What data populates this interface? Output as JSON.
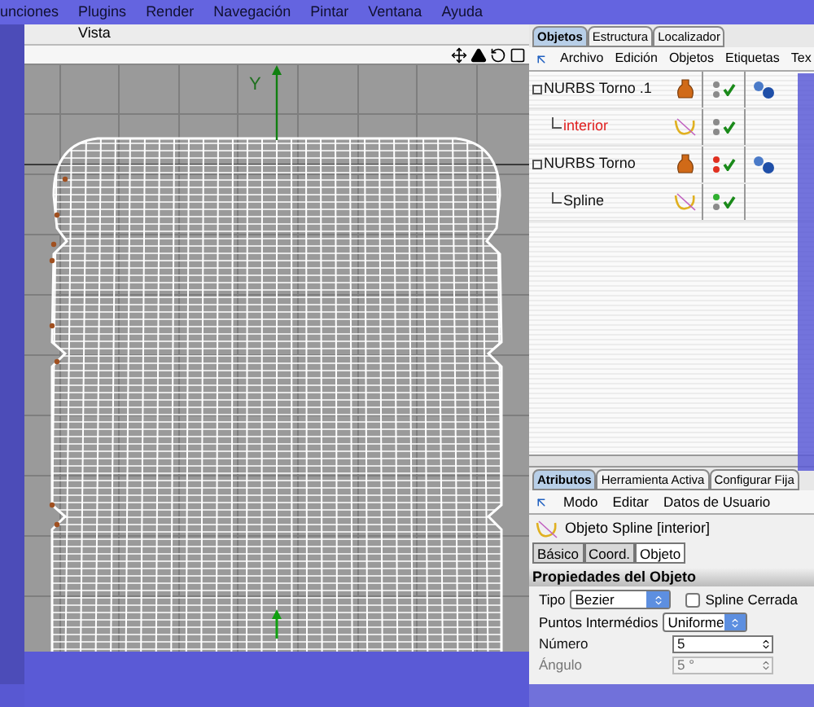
{
  "menu_bar": [
    "unciones",
    "Plugins",
    "Render",
    "Navegación",
    "Pintar",
    "Ventana",
    "Ayuda"
  ],
  "viewport": {
    "title": "Vista",
    "axis_label": "Y"
  },
  "objects_panel": {
    "tabs": [
      {
        "label": "Objetos",
        "selected": true
      },
      {
        "label": "Estructura",
        "selected": false
      },
      {
        "label": "Localizador",
        "selected": false
      }
    ],
    "menu": [
      "Archivo",
      "Edición",
      "Objetos",
      "Etiquetas",
      "Tex"
    ],
    "tree": [
      {
        "name": "NURBS Torno .1",
        "kind": "lathe",
        "selected": false,
        "dots": [
          {
            "color": "#8a8a8a"
          },
          {
            "color": "#8a8a8a"
          }
        ],
        "tag": true,
        "children": [
          {
            "name": "interior",
            "kind": "spline",
            "selected": true,
            "dots": [
              {
                "color": "#8a8a8a"
              },
              {
                "color": "#8a8a8a"
              }
            ],
            "tag": false
          }
        ]
      },
      {
        "name": "NURBS Torno",
        "kind": "lathe",
        "selected": false,
        "dots": [
          {
            "color": "#e03020"
          },
          {
            "color": "#e03020"
          }
        ],
        "tag": true,
        "children": [
          {
            "name": "Spline",
            "kind": "spline",
            "selected": false,
            "dots": [
              {
                "color": "#30b030"
              },
              {
                "color": "#8a8a8a"
              }
            ],
            "tag": false
          }
        ]
      }
    ]
  },
  "attributes_panel": {
    "tabs": [
      {
        "label": "Atributos",
        "selected": true
      },
      {
        "label": "Herramienta Activa",
        "selected": false
      },
      {
        "label": "Configurar Fija",
        "selected": false
      }
    ],
    "menu": [
      "Modo",
      "Editar",
      "Datos de Usuario"
    ],
    "object_title": "Objeto Spline [interior]",
    "subtabs": [
      {
        "label": "Básico",
        "selected": false
      },
      {
        "label": "Coord.",
        "selected": false
      },
      {
        "label": "Objeto",
        "selected": true
      }
    ],
    "section": "Propiedades del Objeto",
    "tipo": {
      "label": "Tipo",
      "value": "Bezier"
    },
    "spline_cerrada": {
      "label": "Spline Cerrada",
      "checked": false
    },
    "puntos": {
      "label": "Puntos Intermédios",
      "value": "Uniforme"
    },
    "numero": {
      "label": "Número",
      "value": "5",
      "disabled": false
    },
    "angulo": {
      "label": "Ángulo",
      "value": "5 °",
      "disabled": true
    }
  }
}
